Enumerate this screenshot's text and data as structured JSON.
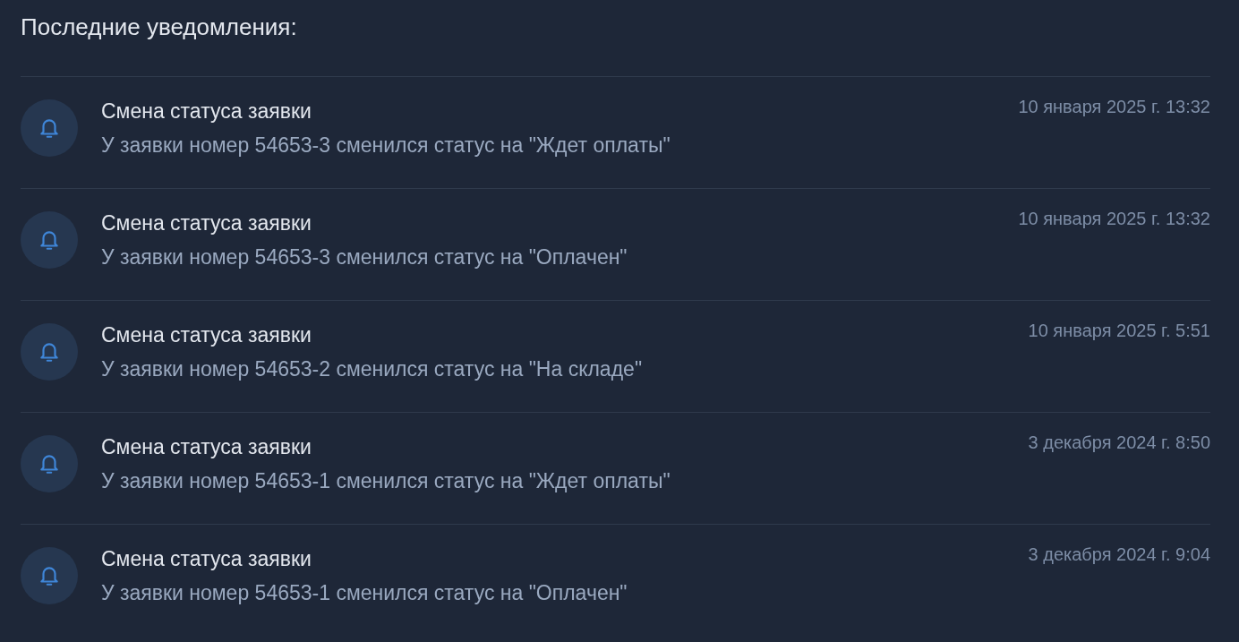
{
  "heading": "Последние уведомления:",
  "notifications": [
    {
      "title": "Смена статуса заявки",
      "message": "У заявки номер 54653-3 сменился статус на \"Ждет оплаты\"",
      "time": "10 января 2025 г. 13:32"
    },
    {
      "title": "Смена статуса заявки",
      "message": "У заявки номер 54653-3 сменился статус на \"Оплачен\"",
      "time": "10 января 2025 г. 13:32"
    },
    {
      "title": "Смена статуса заявки",
      "message": "У заявки номер 54653-2 сменился статус на \"На складе\"",
      "time": "10 января 2025 г. 5:51"
    },
    {
      "title": "Смена статуса заявки",
      "message": "У заявки номер 54653-1 сменился статус на \"Ждет оплаты\"",
      "time": "3 декабря 2024 г. 8:50"
    },
    {
      "title": "Смена статуса заявки",
      "message": "У заявки номер 54653-1 сменился статус на \"Оплачен\"",
      "time": "3 декабря 2024 г. 9:04"
    }
  ]
}
